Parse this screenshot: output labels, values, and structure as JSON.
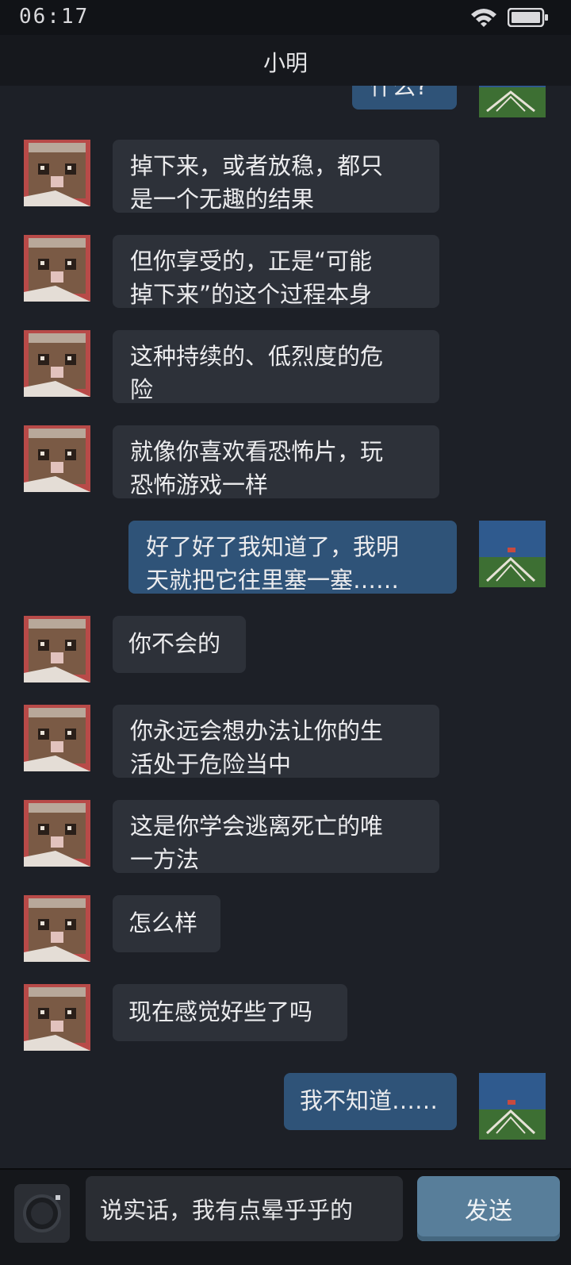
{
  "status_bar": {
    "time": "06:17"
  },
  "header": {
    "title": "小明"
  },
  "messages": [
    {
      "side": "out",
      "text": "什么?"
    },
    {
      "side": "in",
      "lines": [
        "掉下来，或者放稳，都只",
        "是一个无趣的结果"
      ]
    },
    {
      "side": "in",
      "lines": [
        "但你享受的，正是“可能",
        "掉下来”的这个过程本身"
      ]
    },
    {
      "side": "in",
      "lines": [
        "这种持续的、低烈度的危",
        "险"
      ]
    },
    {
      "side": "in",
      "lines": [
        "就像你喜欢看恐怖片，玩",
        "恐怖游戏一样"
      ]
    },
    {
      "side": "out",
      "lines": [
        "好了好了我知道了，我明",
        "天就把它往里塞一塞……"
      ]
    },
    {
      "side": "in",
      "lines": [
        "你不会的"
      ]
    },
    {
      "side": "in",
      "lines": [
        "你永远会想办法让你的生",
        "活处于危险当中"
      ]
    },
    {
      "side": "in",
      "lines": [
        "这是你学会逃离死亡的唯",
        "一方法"
      ]
    },
    {
      "side": "in",
      "lines": [
        "怎么样"
      ]
    },
    {
      "side": "in",
      "lines": [
        "现在感觉好些了吗"
      ]
    },
    {
      "side": "out",
      "lines": [
        "我不知道……"
      ]
    }
  ],
  "input": {
    "value": "说实话，我有点晕乎乎的",
    "send_label": "发送"
  },
  "colors": {
    "incoming_bubble": "#2d3139",
    "outgoing_bubble": "#2f5378",
    "send_button": "#587e9a",
    "background": "#1d2027"
  },
  "icons": {
    "status": [
      "wifi-icon",
      "battery-icon"
    ],
    "input": "camera-icon",
    "avatars": [
      "contact-avatar-cat",
      "user-avatar-landscape"
    ]
  }
}
